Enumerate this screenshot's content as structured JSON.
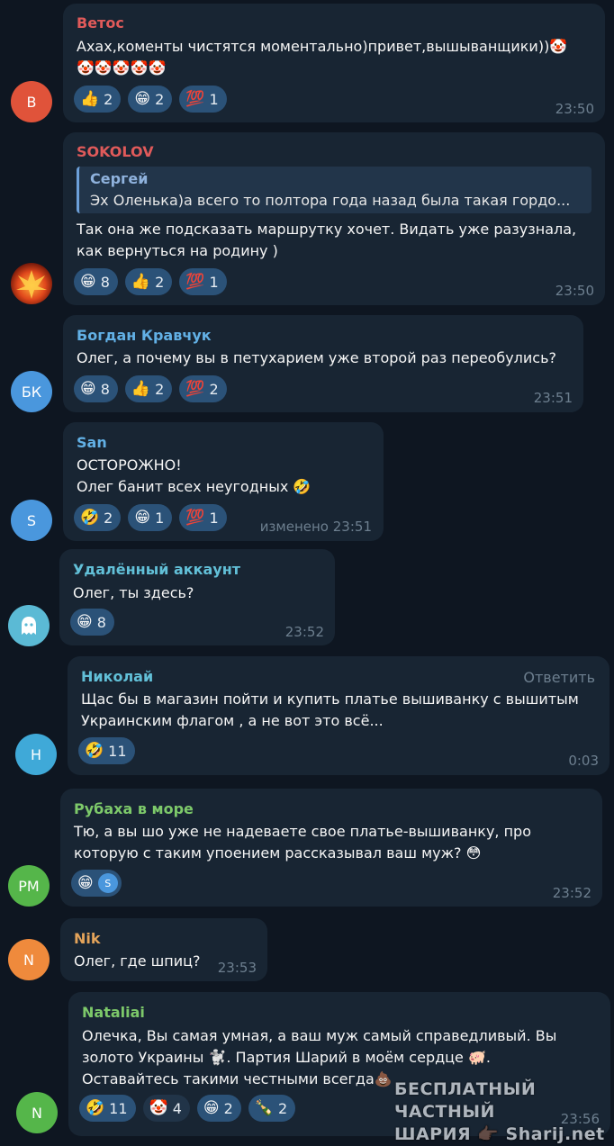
{
  "colors": {
    "background": "#0e1621",
    "bubble": "#182533",
    "reaction_pill": "#2b5278",
    "time": "#6d7f8f"
  },
  "messages": [
    {
      "author": "Ветос",
      "author_color": "#e05a5a",
      "avatar_initials": "В",
      "avatar_color": "#e0533a",
      "text": "Ахах,коменты чистятся моментально)привет,вышыванщики))🤡",
      "text2": "🤡🤡🤡🤡🤡",
      "reactions": [
        {
          "emoji": "👍",
          "count": "2"
        },
        {
          "emoji": "😁",
          "count": "2"
        },
        {
          "emoji": "💯",
          "count": "1"
        }
      ],
      "time": "23:50"
    },
    {
      "author": "SOKOLOV",
      "author_color": "#e05a5a",
      "avatar_icon": "phoenix-avatar",
      "quote_author": "Сергей",
      "quote_text": "Эх Оленька)а всего то полтора года назад была такая гордо...",
      "text": "Так она же подсказать маршрутку хочет. Видать уже разузнала,",
      "text2": "как вернуться на родину )",
      "reactions": [
        {
          "emoji": "😁",
          "count": "8"
        },
        {
          "emoji": "👍",
          "count": "2"
        },
        {
          "emoji": "💯",
          "count": "1"
        }
      ],
      "time": "23:50"
    },
    {
      "author": "Богдан Кравчук",
      "author_color": "#62b0e5",
      "avatar_initials": "БК",
      "avatar_color": "#4a97dd",
      "text": "Олег, а почему вы в петухарием уже второй раз переобулись?",
      "reactions": [
        {
          "emoji": "😁",
          "count": "8"
        },
        {
          "emoji": "👍",
          "count": "2"
        },
        {
          "emoji": "💯",
          "count": "2"
        }
      ],
      "time": "23:51"
    },
    {
      "author": "San",
      "author_color": "#62b0e5",
      "avatar_initials": "S",
      "avatar_color": "#4a97dd",
      "text": "ОСТОРОЖНО!",
      "text2": "Олег банит всех неугодных 🤣",
      "reactions": [
        {
          "emoji": "🤣",
          "count": "2"
        },
        {
          "emoji": "😁",
          "count": "1"
        },
        {
          "emoji": "💯",
          "count": "1"
        }
      ],
      "edited": "изменено",
      "time": "23:51"
    },
    {
      "author": "Удалённый аккаунт",
      "author_color": "#62c0d8",
      "avatar_icon": "ghost-icon",
      "avatar_color": "#5bbad5",
      "text": "Олег, ты здесь?",
      "reactions": [
        {
          "emoji": "😁",
          "count": "8"
        }
      ],
      "time": "23:52"
    },
    {
      "author": "Николай",
      "author_color": "#62c0d8",
      "avatar_initials": "Н",
      "avatar_color": "#3fa9d8",
      "reply_label": "Ответить",
      "text": "Щас бы в магазин пойти и купить платье вышиванку с вышитым",
      "text2": "Украинским флагом , а не вот это всё...",
      "reactions": [
        {
          "emoji": "🤣",
          "count": "11"
        }
      ],
      "time": "0:03"
    },
    {
      "author": "Рубаха в море",
      "author_color": "#7dc96a",
      "avatar_initials": "PM",
      "avatar_color": "#55b64a",
      "text": "Тю, а вы шо уже не надеваете свое платье-вышиванку, про",
      "text2": "которую с таким упоением рассказывал ваш муж? 😳",
      "reactions": [
        {
          "emoji": "😁",
          "count": ""
        }
      ],
      "reactor_initial": "S",
      "time": "23:52"
    },
    {
      "author": "Nik",
      "author_color": "#e3a35a",
      "avatar_initials": "N",
      "avatar_color": "#ef8a3c",
      "text": "Олег, где шпиц?",
      "time": "23:53"
    },
    {
      "author": "Nataliai",
      "author_color": "#7dc96a",
      "avatar_initials": "N",
      "avatar_color": "#55b64a",
      "text": "Олечка, Вы самая умная, а ваш муж самый справедливый. Вы",
      "text2": "золото Украины 🐩. Партия Шарий в моём сердце 🐖.",
      "text3": "Оставайтесь такими честными всегда💩",
      "reactions": [
        {
          "emoji": "🤣",
          "count": "11"
        },
        {
          "emoji": "🤡",
          "count": "4"
        },
        {
          "emoji": "😁",
          "count": "2"
        },
        {
          "emoji": "🍾",
          "count": "2"
        }
      ],
      "time": "23:56"
    }
  ],
  "watermark": {
    "line1": "БЕСПЛАТНЫЙ ЧАСТНЫЙ",
    "line2": "ШАРИЯ 👉🏿 Sharij.net"
  }
}
